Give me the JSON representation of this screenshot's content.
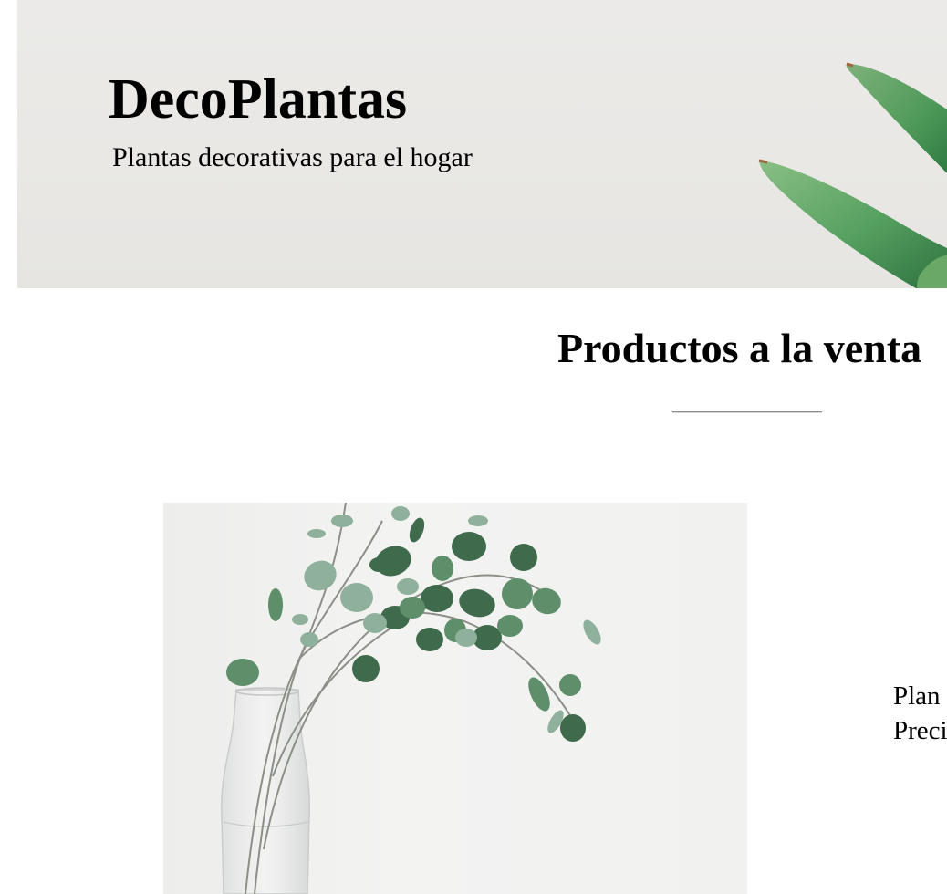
{
  "header": {
    "title": "DecoPlantas",
    "subtitle": "Plantas decorativas para el hogar",
    "banner_icon": "aloe-leaves-image"
  },
  "products_section": {
    "title": "Productos a la venta",
    "divider": "horizontal-rule"
  },
  "products": [
    {
      "image_icon": "eucalyptus-vase-image",
      "name_label": "Plan",
      "price_label": "Preci"
    }
  ],
  "colors": {
    "banner_background": "#e9e8e5",
    "leaf_green": "#4f9a5a",
    "leaf_dark": "#3f6b4c",
    "divider": "#8a8a8a",
    "text": "#000000"
  }
}
